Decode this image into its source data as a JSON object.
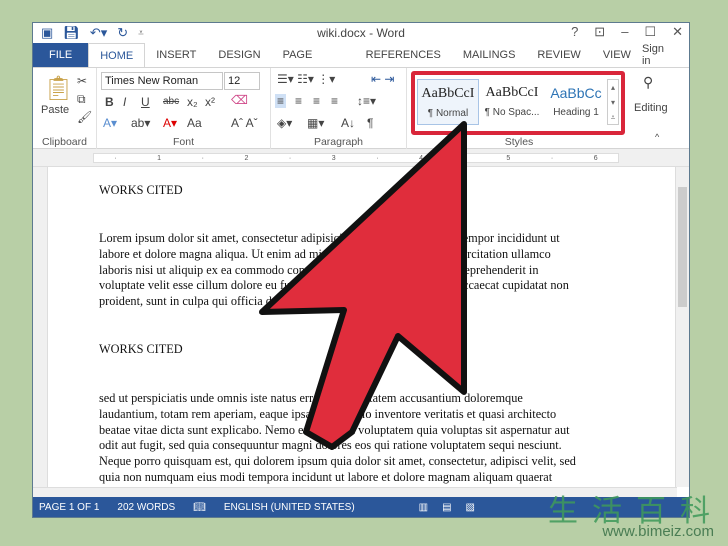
{
  "window": {
    "title": "wiki.docx - Word",
    "help": "?",
    "controls": [
      "ribbon-display",
      "minimize",
      "maximize",
      "close"
    ]
  },
  "tabs": [
    {
      "label": "FILE"
    },
    {
      "label": "HOME",
      "active": true
    },
    {
      "label": "INSERT"
    },
    {
      "label": "DESIGN"
    },
    {
      "label": "PAGE LAYOUT"
    },
    {
      "label": "REFERENCES"
    },
    {
      "label": "MAILINGS"
    },
    {
      "label": "REVIEW"
    },
    {
      "label": "VIEW"
    }
  ],
  "signin": "Sign in",
  "ribbon": {
    "clipboard": {
      "label": "Clipboard",
      "paste": "Paste"
    },
    "font": {
      "label": "Font",
      "name": "Times New Roman",
      "size": "12",
      "bold": "B",
      "italic": "I",
      "underline": "U",
      "strike": "abc",
      "sub": "x₂",
      "sup": "x²",
      "case": "Aa"
    },
    "paragraph": {
      "label": "Paragraph",
      "pilcrow": "¶"
    },
    "styles": {
      "label": "Styles",
      "items": [
        {
          "preview": "AaBbCcI",
          "name": "¶ Normal"
        },
        {
          "preview": "AaBbCcI",
          "name": "¶ No Spac..."
        },
        {
          "preview": "AaBbCc",
          "name": "Heading 1"
        }
      ]
    },
    "editing": {
      "label": "Editing"
    }
  },
  "document": {
    "heading1": "WORKS CITED",
    "para1": [
      "Lorem ipsum dolor sit amet, consectetur adipisicing elit, sed do eiusmod tempor incididunt ut",
      "labore et dolore magna aliqua. Ut enim ad minim veniam, quis nostrud exercitation ullamco",
      "laboris nisi ut aliquip ex ea commodo consequat. Duis aute irure dolor in reprehenderit in",
      "voluptate velit esse cillum dolore eu fugiat nulla pariatur. Excepteur sint occaecat cupidatat non",
      "proident, sunt in culpa qui officia deserunt mollit anim id est laborum."
    ],
    "heading2": "WORKS CITED",
    "para2": [
      "sed ut perspiciatis unde omnis iste natus error sit voluptatem accusantium doloremque",
      "laudantium, totam rem aperiam, eaque ipsa quae ab illo inventore veritatis et quasi architecto",
      "beatae vitae dicta sunt explicabo. Nemo enim ipsam voluptatem quia voluptas sit aspernatur aut",
      "odit aut fugit, sed quia consequuntur magni dolores eos qui ratione voluptatem sequi nesciunt.",
      "Neque porro quisquam est, qui dolorem ipsum quia dolor sit amet, consectetur, adipisci velit, sed",
      "quia non numquam eius modi tempora incidunt ut labore et dolore magnam aliquam quaerat"
    ]
  },
  "status": {
    "page": "PAGE 1 OF 1",
    "words": "202 WORDS",
    "language": "ENGLISH (UNITED STATES)"
  },
  "colors": {
    "accent": "#2b579a",
    "highlight": "#d9263a",
    "arrow": "#e02d3c"
  },
  "watermark": {
    "text": "生活百科",
    "url": "www.bimeiz.com"
  }
}
